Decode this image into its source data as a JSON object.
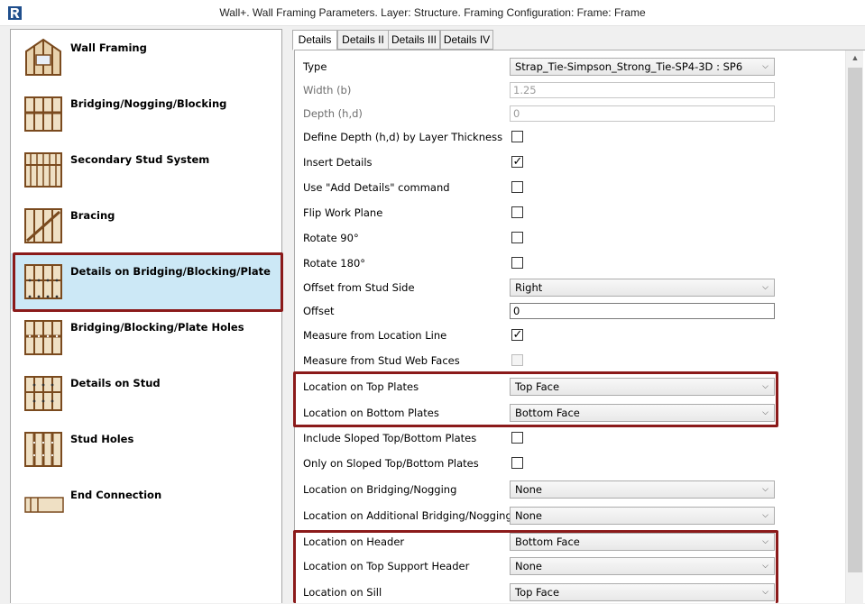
{
  "window": {
    "title": "Wall+. Wall Framing Parameters. Layer: Structure. Framing Configuration: Frame: Frame",
    "app_icon": "revit-logo-icon"
  },
  "nav": {
    "items": [
      {
        "label": "Wall Framing",
        "icon": "wall-framing-icon"
      },
      {
        "label": "Bridging/Nogging/Blocking",
        "icon": "bridging-icon"
      },
      {
        "label": "Secondary Stud System",
        "icon": "secondary-stud-icon"
      },
      {
        "label": "Bracing",
        "icon": "bracing-icon"
      },
      {
        "label": "Details on Bridging/Blocking/Plate",
        "icon": "details-bridging-icon",
        "selected": true
      },
      {
        "label": "Bridging/Blocking/Plate Holes",
        "icon": "plate-holes-icon"
      },
      {
        "label": "Details on Stud",
        "icon": "details-stud-icon"
      },
      {
        "label": "Stud Holes",
        "icon": "stud-holes-icon"
      },
      {
        "label": "End Connection",
        "icon": "end-connection-icon"
      }
    ]
  },
  "tabs": [
    {
      "label": "Details",
      "active": true
    },
    {
      "label": "Details II"
    },
    {
      "label": "Details III"
    },
    {
      "label": "Details IV"
    }
  ],
  "props": {
    "type": {
      "label": "Type",
      "value": "Strap_Tie-Simpson_Strong_Tie-SP4-3D : SP6"
    },
    "width": {
      "label": "Width (b)",
      "value": "1.25"
    },
    "depth": {
      "label": "Depth (h,d)",
      "value": "0"
    },
    "define_depth": {
      "label": "Define Depth (h,d) by Layer Thickness",
      "checked": false
    },
    "insert_details": {
      "label": "Insert Details",
      "checked": true
    },
    "add_details_cmd": {
      "label": "Use \"Add Details\" command",
      "checked": false
    },
    "flip_work_plane": {
      "label": "Flip Work Plane",
      "checked": false
    },
    "rotate90": {
      "label": "Rotate 90°",
      "checked": false
    },
    "rotate180": {
      "label": "Rotate 180°",
      "checked": false
    },
    "offset_side": {
      "label": "Offset from Stud Side",
      "value": "Right"
    },
    "offset": {
      "label": "Offset",
      "value": "0"
    },
    "measure_location": {
      "label": "Measure from Location Line",
      "checked": true
    },
    "measure_web": {
      "label": "Measure from Stud Web Faces",
      "checked": false
    },
    "loc_top_plates": {
      "label": "Location on Top Plates",
      "value": "Top Face"
    },
    "loc_bottom_plates": {
      "label": "Location on Bottom Plates",
      "value": "Bottom Face"
    },
    "include_sloped": {
      "label": "Include Sloped Top/Bottom Plates",
      "checked": false
    },
    "only_sloped": {
      "label": "Only on Sloped Top/Bottom Plates",
      "checked": false
    },
    "loc_bridging": {
      "label": "Location on Bridging/Nogging",
      "value": "None"
    },
    "loc_add_bridging": {
      "label": "Location on Additional Bridging/Nogging",
      "value": "None"
    },
    "loc_header": {
      "label": "Location on Header",
      "value": "Bottom Face"
    },
    "loc_top_support": {
      "label": "Location on Top Support Header",
      "value": "None"
    },
    "loc_sill": {
      "label": "Location on Sill",
      "value": "Top Face"
    }
  },
  "colors": {
    "highlight": "#8b1a1a",
    "selected_bg": "#cce8f6",
    "wood": "#d9b483",
    "wood_dark": "#7a4a1e"
  }
}
